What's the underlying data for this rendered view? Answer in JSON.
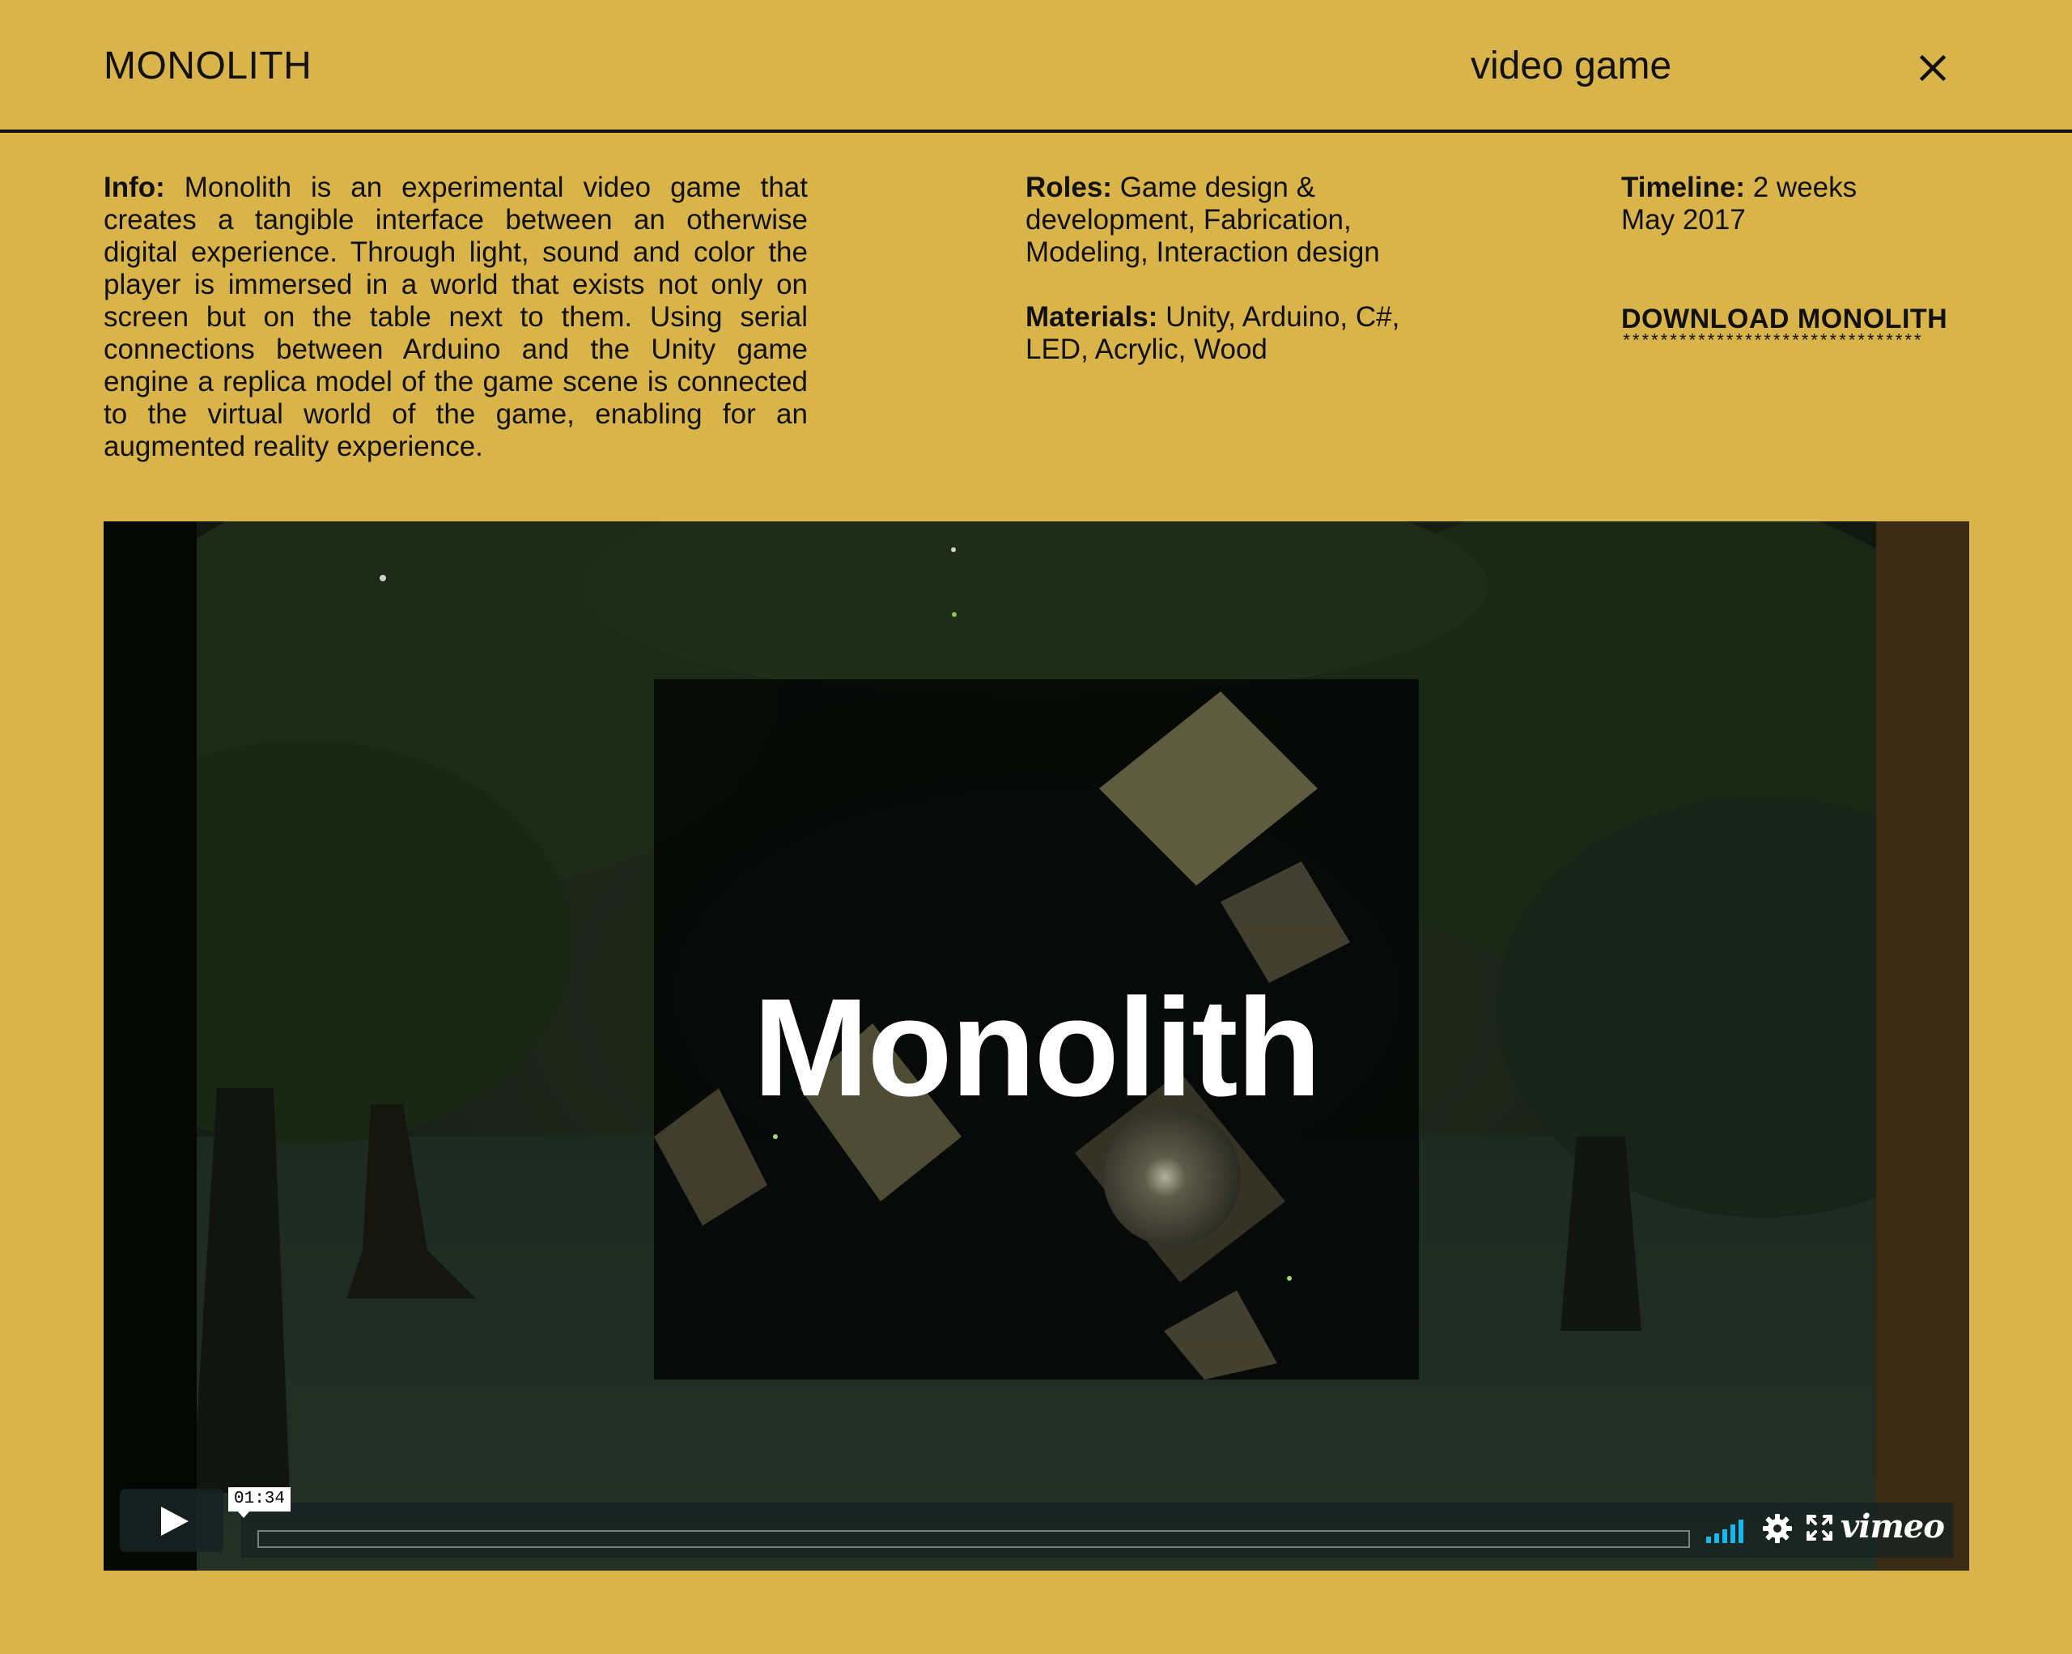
{
  "header": {
    "title": "MONOLITH",
    "category": "video game",
    "close_icon": "close-icon"
  },
  "info": {
    "label": "Info:",
    "text": " Monolith is an experimental video game that creates a tangible interface between an otherwise digital experience. Through light, sound and color the player is immersed in a world that exists not only on screen but on the table next to them. Using serial connections between Arduino and the Unity game engine a replica model of the game scene is connected to the virtual world of the game, enabling for an augmented reality experience."
  },
  "roles": {
    "label": "Roles:",
    "text": " Game design & development, Fabrication, Modeling, Interaction design"
  },
  "materials": {
    "label": "Materials:",
    "text": " Unity, Arduino, C#, LED, Acrylic, Wood"
  },
  "timeline": {
    "label": "Timeline:",
    "duration": " 2 weeks",
    "date": "May 2017"
  },
  "download": {
    "label": "DOWNLOAD MONOLITH",
    "underline": "********************************"
  },
  "video": {
    "title": "Monolith",
    "time": "01:34",
    "progress": 0,
    "brand": "vimeo",
    "icons": {
      "play": "play-icon",
      "volume": "volume-icon",
      "settings": "gear-icon",
      "fullscreen": "fullscreen-icon"
    },
    "colors": {
      "volume_bars": "#1ab7ea"
    }
  },
  "colors": {
    "page_background": "#D9B44A",
    "text": "#111111"
  }
}
